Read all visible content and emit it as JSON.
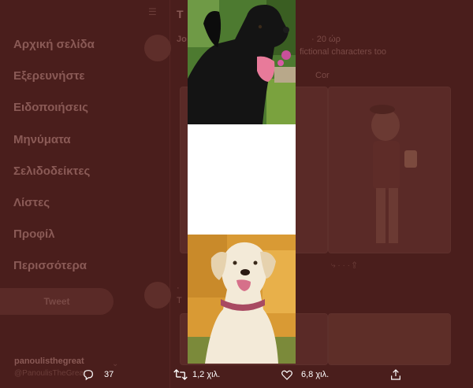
{
  "sidebar": {
    "items": [
      {
        "label": "Αρχική σελίδα"
      },
      {
        "label": "Εξερευνήστε"
      },
      {
        "label": "Ειδοποιήσεις"
      },
      {
        "label": "Μηνύματα"
      },
      {
        "label": "Σελιδοδείκτες"
      },
      {
        "label": "Λίστες"
      },
      {
        "label": "Προφίλ"
      },
      {
        "label": "Περισσότερα"
      }
    ],
    "tweet_button": "Tweet",
    "account": {
      "name": "panoulisthegreat",
      "handle": "@PanoulisTheGreat"
    }
  },
  "feed": {
    "header": "T",
    "tweet1": {
      "author": "Jo",
      "meta": "· 20 ώρ",
      "text": "fictional characters too",
      "button": "Cor"
    },
    "tweet2": {
      "author": "·",
      "line2": "T"
    }
  },
  "actions": {
    "reply_count": "37",
    "retweet_count": "1,2 χιλ.",
    "like_count": "6,8 χιλ."
  }
}
